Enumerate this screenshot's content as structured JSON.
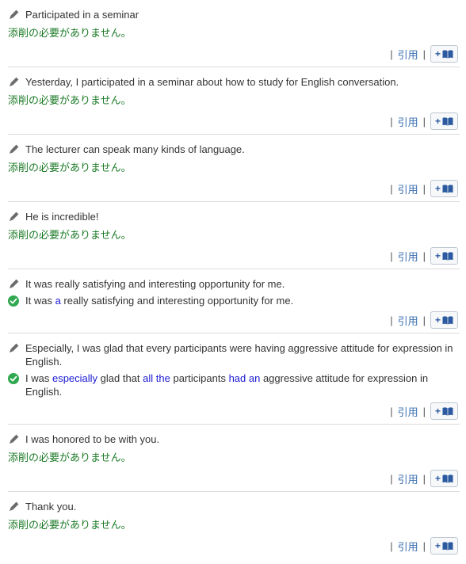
{
  "labels": {
    "no_correction": "添削の必要がありません。",
    "quote": "引用",
    "pipe": "|",
    "plus": "+"
  },
  "icons": {
    "pencil": "pencil-icon",
    "check": "check-circle-icon",
    "book": "book-icon"
  },
  "colors": {
    "no_correction_green": "#1b7a26",
    "highlight_blue": "#1a1ad6",
    "link_blue": "#3a6fb0",
    "check_green": "#2fa84f"
  },
  "entries": [
    {
      "original": "Participated in a seminar",
      "correction": null
    },
    {
      "original": "Yesterday, I participated in a seminar about how to study for English conversation.",
      "correction": null
    },
    {
      "original": "The lecturer can speak many kinds of language.",
      "correction": null
    },
    {
      "original": "He is incredible!",
      "correction": null
    },
    {
      "original": "It was really satisfying and interesting opportunity for me.",
      "correction": [
        {
          "text": "It was ",
          "hl": false
        },
        {
          "text": "a",
          "hl": true
        },
        {
          "text": " really satisfying and interesting opportunity for me.",
          "hl": false
        }
      ]
    },
    {
      "original": "Especially, I was glad that every participants were having aggressive attitude for expression in English.",
      "correction": [
        {
          "text": "I was ",
          "hl": false
        },
        {
          "text": "especially",
          "hl": true
        },
        {
          "text": " glad that ",
          "hl": false
        },
        {
          "text": "all the",
          "hl": true
        },
        {
          "text": " participants ",
          "hl": false
        },
        {
          "text": "had an",
          "hl": true
        },
        {
          "text": " aggressive attitude for expression in English.",
          "hl": false
        }
      ]
    },
    {
      "original": "I was honored to be with you.",
      "correction": null
    },
    {
      "original": "Thank you.",
      "correction": null
    }
  ]
}
